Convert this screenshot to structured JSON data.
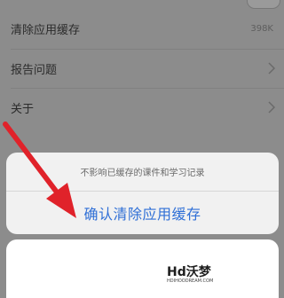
{
  "settings": {
    "items": [
      {
        "label": "清除应用缓存",
        "value": "398K"
      },
      {
        "label": "报告问题"
      },
      {
        "label": "关于"
      }
    ]
  },
  "dialog": {
    "message": "不影响已缓存的课件和学习记录",
    "confirm_label": "确认清除应用缓存"
  },
  "watermark": {
    "main": "Hd沃梦",
    "sub": "HDIHOODREAM.COM"
  },
  "colors": {
    "accent": "#2f6fd6",
    "arrow": "#e0222a",
    "overlay": "#8c8c8c"
  },
  "icons": {
    "chevron": "chevron-right-icon",
    "arrow": "red-arrow-annotation"
  }
}
